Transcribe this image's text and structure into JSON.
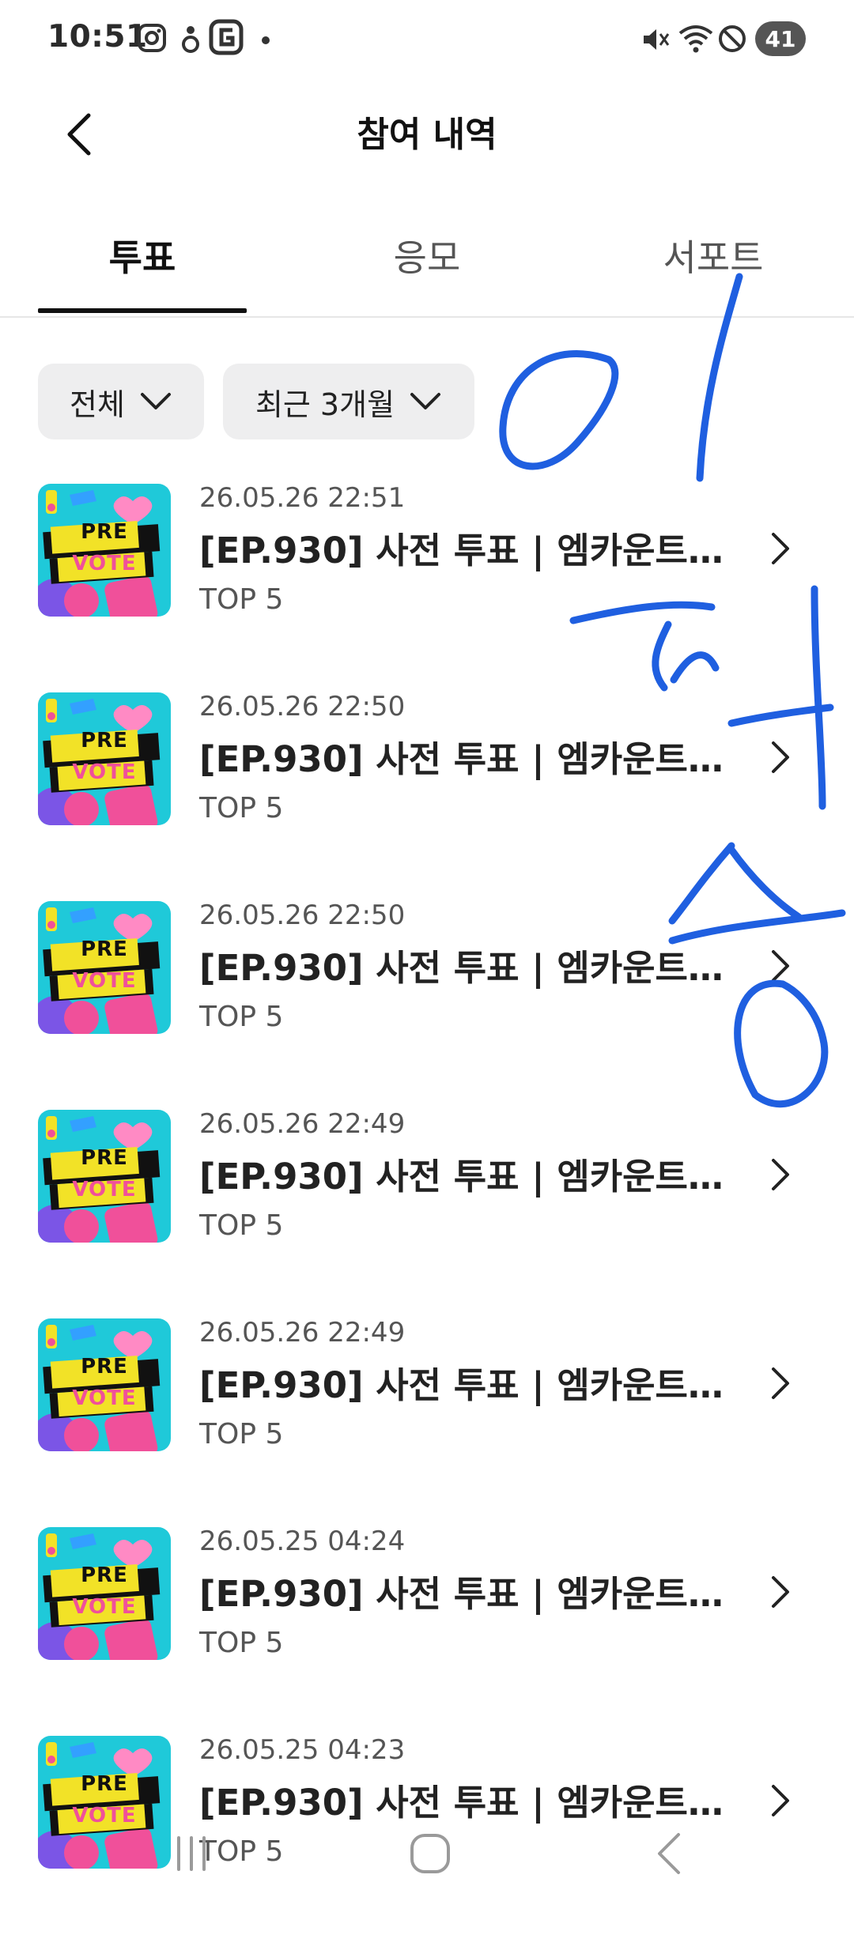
{
  "status_bar": {
    "time": "10:51",
    "battery": "41",
    "left_icons": [
      "instagram-icon",
      "app-notification-icon",
      "g-app-icon",
      "dot-icon"
    ],
    "right_icons": [
      "mute-icon",
      "wifi-icon",
      "blocked-icon"
    ]
  },
  "header": {
    "title": "참여 내역",
    "back_icon": "chevron-left-icon"
  },
  "tabs": [
    {
      "label": "투표",
      "active": true
    },
    {
      "label": "응모",
      "active": false
    },
    {
      "label": "서포트",
      "active": false
    }
  ],
  "filters": {
    "type": "전체",
    "period": "최근 3개월"
  },
  "thumbnail": {
    "line1": "PRE",
    "line2": "VOTE",
    "colors": {
      "bg": "#1fc9d9",
      "banner": "#f2e227",
      "pink": "#f0509a",
      "purple": "#7b55e6",
      "dark": "#111111"
    }
  },
  "items": [
    {
      "date": "26.05.26 22:51",
      "title": "[EP.930] 사전 투표 | 엠카운트다...",
      "sub": "TOP 5"
    },
    {
      "date": "26.05.26 22:50",
      "title": "[EP.930] 사전 투표 | 엠카운트다...",
      "sub": "TOP 5"
    },
    {
      "date": "26.05.26 22:50",
      "title": "[EP.930] 사전 투표 | 엠카운트다...",
      "sub": "TOP 5"
    },
    {
      "date": "26.05.26 22:49",
      "title": "[EP.930] 사전 투표 | 엠카운트다...",
      "sub": "TOP 5"
    },
    {
      "date": "26.05.26 22:49",
      "title": "[EP.930] 사전 투표 | 엠카운트다...",
      "sub": "TOP 5"
    },
    {
      "date": "26.05.25 04:24",
      "title": "[EP.930] 사전 투표 | 엠카운트다...",
      "sub": "TOP 5"
    },
    {
      "date": "26.05.25 04:23",
      "title": "[EP.930] 사전 투표 | 엠카운트다...",
      "sub": "TOP 5"
    }
  ],
  "handwriting": {
    "text": "이 파 송",
    "color": "#1f5fe0"
  },
  "nav_bar": {
    "icons": [
      "recent-apps-icon",
      "home-icon",
      "back-icon"
    ]
  }
}
